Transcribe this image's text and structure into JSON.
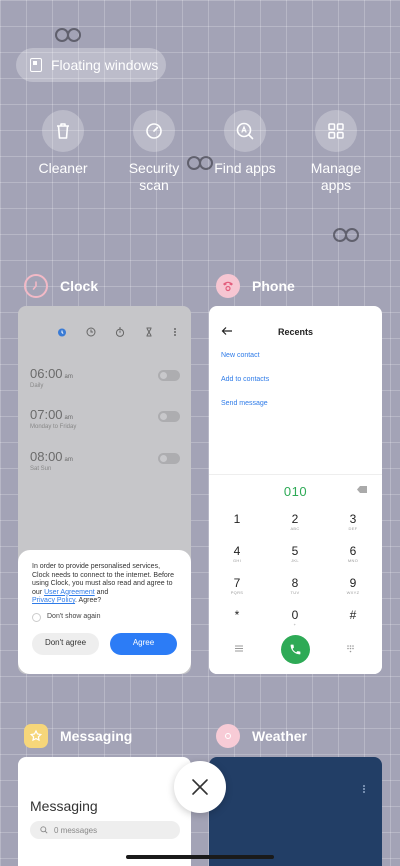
{
  "floating_windows": {
    "label": "Floating windows"
  },
  "quick_actions": [
    {
      "label": "Cleaner",
      "icon": "trash-icon"
    },
    {
      "label": "Security\nscan",
      "icon": "shield-icon"
    },
    {
      "label": "Find apps",
      "icon": "find-apps-icon"
    },
    {
      "label": "Manage\napps",
      "icon": "grid-icon"
    }
  ],
  "recents": {
    "clock": {
      "name": "Clock",
      "alarms": [
        {
          "time": "06:00",
          "suffix": "am",
          "label": "Daily"
        },
        {
          "time": "07:00",
          "suffix": "am",
          "label": "Monday to Friday"
        },
        {
          "time": "08:00",
          "suffix": "am",
          "label": "Sat Sun"
        }
      ],
      "dialog": {
        "text_1": "In order to provide personalised services, Clock needs to connect to the internet. Before using Clock, you must also read and agree to our",
        "link_1": "User Agreement",
        "text_2": "and",
        "link_2": "Privacy Policy",
        "text_3": ". Agree?",
        "checkbox_label": "Don't show again",
        "decline_label": "Don't agree",
        "accept_label": "Agree"
      }
    },
    "phone": {
      "name": "Phone",
      "title": "Recents",
      "links": [
        "New contact",
        "Add to contacts",
        "Send message"
      ],
      "number": "010",
      "keys": [
        {
          "d": "1",
          "l": ""
        },
        {
          "d": "2",
          "l": "ABC"
        },
        {
          "d": "3",
          "l": "DEF"
        },
        {
          "d": "4",
          "l": "GHI"
        },
        {
          "d": "5",
          "l": "JKL"
        },
        {
          "d": "6",
          "l": "MNO"
        },
        {
          "d": "7",
          "l": "PQRS"
        },
        {
          "d": "8",
          "l": "TUV"
        },
        {
          "d": "9",
          "l": "WXYZ"
        },
        {
          "d": "*",
          "l": ""
        },
        {
          "d": "0",
          "l": "+"
        },
        {
          "d": "#",
          "l": ""
        }
      ]
    },
    "messaging": {
      "name": "Messaging",
      "title": "Messaging",
      "search_placeholder": "0 messages"
    },
    "weather": {
      "name": "Weather"
    }
  },
  "colors": {
    "accent": "#2c7cf6",
    "call_green": "#2eaa56",
    "background": "#a3a3b6"
  }
}
